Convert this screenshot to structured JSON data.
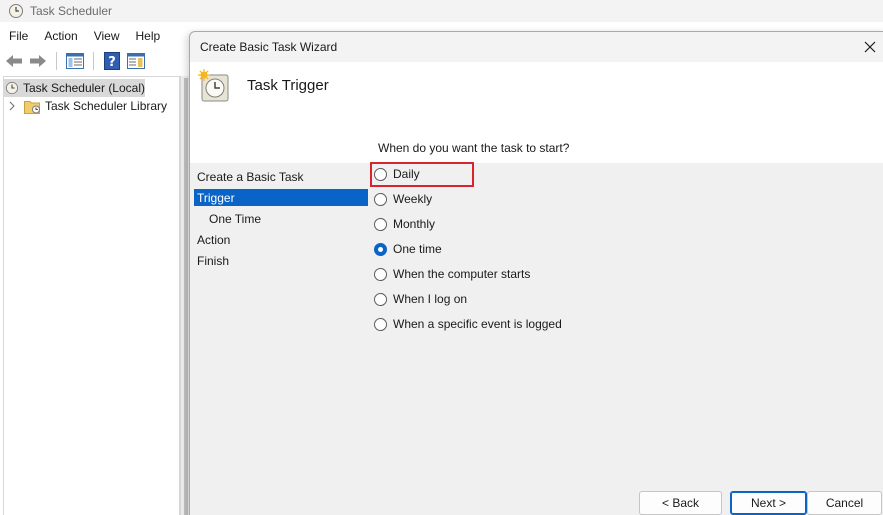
{
  "app": {
    "title": "Task Scheduler",
    "menu": [
      "File",
      "Action",
      "View",
      "Help"
    ],
    "tree": {
      "root_label": "Task Scheduler (Local)",
      "library_label": "Task Scheduler Library"
    }
  },
  "wizard": {
    "title": "Create Basic Task Wizard",
    "header_title": "Task Trigger",
    "steps": [
      {
        "label": "Create a Basic Task",
        "active": false,
        "sub": false
      },
      {
        "label": "Trigger",
        "active": true,
        "sub": false
      },
      {
        "label": "One Time",
        "active": false,
        "sub": true
      },
      {
        "label": "Action",
        "active": false,
        "sub": false
      },
      {
        "label": "Finish",
        "active": false,
        "sub": false
      }
    ],
    "question": "When do you want the task to start?",
    "options": [
      {
        "label": "Daily",
        "checked": false
      },
      {
        "label": "Weekly",
        "checked": false
      },
      {
        "label": "Monthly",
        "checked": false
      },
      {
        "label": "One time",
        "checked": true
      },
      {
        "label": "When the computer starts",
        "checked": false
      },
      {
        "label": "When I log on",
        "checked": false
      },
      {
        "label": "When a specific event is logged",
        "checked": false
      }
    ],
    "buttons": {
      "back": "< Back",
      "next": "Next >",
      "cancel": "Cancel"
    }
  },
  "colors": {
    "accent": "#0a64c8",
    "highlight_border": "#d9232e"
  }
}
